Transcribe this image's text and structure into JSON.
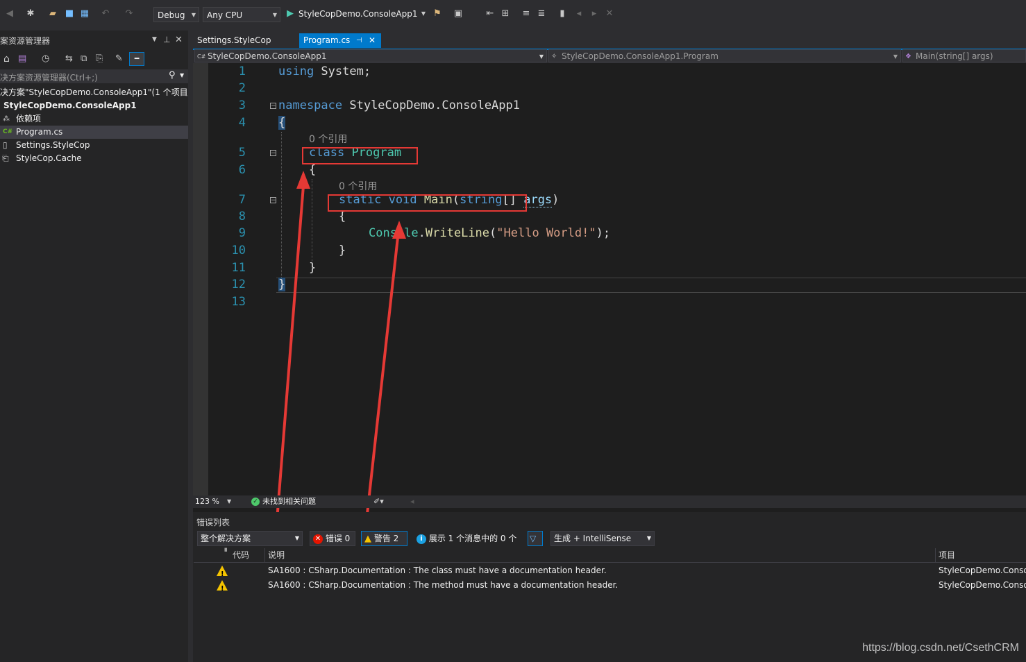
{
  "toolbar": {
    "config": "Debug",
    "platform": "Any CPU",
    "startup": "StyleCopDemo.ConsoleApp1"
  },
  "solution_explorer": {
    "title": "案资源管理器",
    "search_placeholder": "决方案资源管理器(Ctrl+;)",
    "solution_label": "决方案\"StyleCopDemo.ConsoleApp1\"(1 个项目/:",
    "project": "StyleCopDemo.ConsoleApp1",
    "items": [
      {
        "label": "依赖项",
        "icon": "dependencies-icon"
      },
      {
        "label": "Program.cs",
        "icon": "csharp-file-icon",
        "selected": true
      },
      {
        "label": "Settings.StyleCop",
        "icon": "file-icon"
      },
      {
        "label": "StyleCop.Cache",
        "icon": "cache-file-icon"
      }
    ]
  },
  "editor": {
    "tabs": [
      {
        "label": "Settings.StyleCop",
        "active": false
      },
      {
        "label": "Program.cs",
        "active": true
      }
    ],
    "nav": {
      "project": "StyleCopDemo.ConsoleApp1",
      "type": "StyleCopDemo.ConsoleApp1.Program",
      "member": "Main(string[] args)"
    },
    "line_numbers": [
      "1",
      "2",
      "3",
      "4",
      "5",
      "6",
      "7",
      "8",
      "9",
      "10",
      "11",
      "12",
      "13"
    ],
    "codelens": "0 个引用",
    "zoom": "123 %",
    "status": "未找到相关问题"
  },
  "error_list": {
    "title": "错误列表",
    "scope": "整个解决方案",
    "errors_label": "错误 0",
    "warnings_label": "警告 2",
    "messages_label": "展示 1 个消息中的 0 个",
    "source": "生成 + IntelliSense",
    "columns": {
      "code": "代码",
      "description": "说明",
      "project": "项目"
    },
    "rows": [
      {
        "description": "SA1600 : CSharp.Documentation : The class must have a documentation header.",
        "project": "StyleCopDemo.Conso"
      },
      {
        "description": "SA1600 : CSharp.Documentation : The method must have a documentation header.",
        "project": "StyleCopDemo.Conso"
      }
    ]
  },
  "colors": {
    "accent": "#007acc",
    "annotation": "#e53935",
    "warning": "#f5c400"
  },
  "watermark": "https://blog.csdn.net/CsethCRM"
}
